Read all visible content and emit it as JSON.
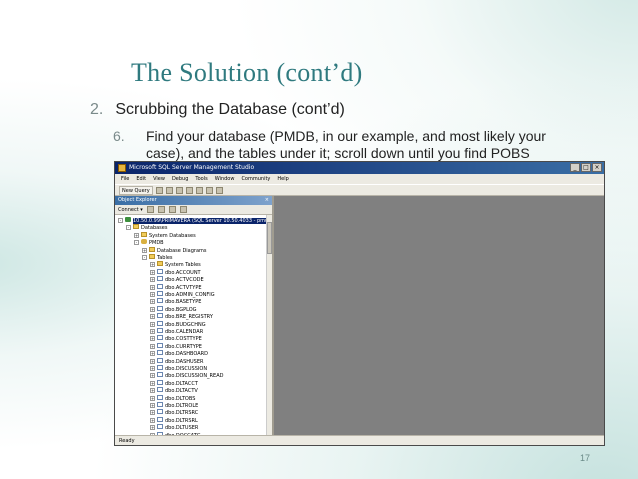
{
  "slide": {
    "title": "The Solution (cont’d)",
    "item_number": "2.",
    "item_text": "Scrubbing the Database (cont’d)",
    "sub_number": "6.",
    "sub_text": "Find your database (PMDB, in our example, and most likely your case), and the tables under it; scroll down until you find POBS",
    "page_number": "17"
  },
  "ssms": {
    "title": "Microsoft SQL Server Management Studio",
    "menu": [
      "File",
      "Edit",
      "View",
      "Debug",
      "Tools",
      "Window",
      "Community",
      "Help"
    ],
    "toolbar": {
      "new_query": "New Query"
    },
    "object_explorer": {
      "title": "Object Explorer",
      "connect_label": "Connect ▾",
      "close": "×",
      "tree": [
        {
          "label": "10.50.0.99\\PRIMAVERA (SQL Server 10.50.4033 - pmuser)",
          "level": 0,
          "type": "server",
          "exp": "-",
          "selected": true
        },
        {
          "label": "Databases",
          "level": 1,
          "type": "folder",
          "exp": "-"
        },
        {
          "label": "System Databases",
          "level": 2,
          "type": "folder",
          "exp": "+"
        },
        {
          "label": "PMDB",
          "level": 2,
          "type": "db",
          "exp": "-"
        },
        {
          "label": "Database Diagrams",
          "level": 3,
          "type": "folder",
          "exp": "+"
        },
        {
          "label": "Tables",
          "level": 3,
          "type": "folder",
          "exp": "-"
        },
        {
          "label": "System Tables",
          "level": 4,
          "type": "folder",
          "exp": "+"
        },
        {
          "label": "dbo.ACCOUNT",
          "level": 4,
          "type": "table",
          "exp": "+"
        },
        {
          "label": "dbo.ACTVCODE",
          "level": 4,
          "type": "table",
          "exp": "+"
        },
        {
          "label": "dbo.ACTVTYPE",
          "level": 4,
          "type": "table",
          "exp": "+"
        },
        {
          "label": "dbo.ADMIN_CONFIG",
          "level": 4,
          "type": "table",
          "exp": "+"
        },
        {
          "label": "dbo.BASETYPE",
          "level": 4,
          "type": "table",
          "exp": "+"
        },
        {
          "label": "dbo.BGPLOG",
          "level": 4,
          "type": "table",
          "exp": "+"
        },
        {
          "label": "dbo.BRE_REGISTRY",
          "level": 4,
          "type": "table",
          "exp": "+"
        },
        {
          "label": "dbo.BUDGCHNG",
          "level": 4,
          "type": "table",
          "exp": "+"
        },
        {
          "label": "dbo.CALENDAR",
          "level": 4,
          "type": "table",
          "exp": "+"
        },
        {
          "label": "dbo.COSTTYPE",
          "level": 4,
          "type": "table",
          "exp": "+"
        },
        {
          "label": "dbo.CURRTYPE",
          "level": 4,
          "type": "table",
          "exp": "+"
        },
        {
          "label": "dbo.DASHBOARD",
          "level": 4,
          "type": "table",
          "exp": "+"
        },
        {
          "label": "dbo.DASHUSER",
          "level": 4,
          "type": "table",
          "exp": "+"
        },
        {
          "label": "dbo.DISCUSSION",
          "level": 4,
          "type": "table",
          "exp": "+"
        },
        {
          "label": "dbo.DISCUSSION_READ",
          "level": 4,
          "type": "table",
          "exp": "+"
        },
        {
          "label": "dbo.DLTACCT",
          "level": 4,
          "type": "table",
          "exp": "+"
        },
        {
          "label": "dbo.DLTACTV",
          "level": 4,
          "type": "table",
          "exp": "+"
        },
        {
          "label": "dbo.DLTOBS",
          "level": 4,
          "type": "table",
          "exp": "+"
        },
        {
          "label": "dbo.DLTROLE",
          "level": 4,
          "type": "table",
          "exp": "+"
        },
        {
          "label": "dbo.DLTRSRC",
          "level": 4,
          "type": "table",
          "exp": "+"
        },
        {
          "label": "dbo.DLTRSRL",
          "level": 4,
          "type": "table",
          "exp": "+"
        },
        {
          "label": "dbo.DLTUSER",
          "level": 4,
          "type": "table",
          "exp": "+"
        },
        {
          "label": "dbo.DOCCATG",
          "level": 4,
          "type": "table",
          "exp": "+"
        },
        {
          "label": "dbo.DOCREVIEW",
          "level": 4,
          "type": "table",
          "exp": "+"
        }
      ]
    },
    "status": "Ready"
  }
}
